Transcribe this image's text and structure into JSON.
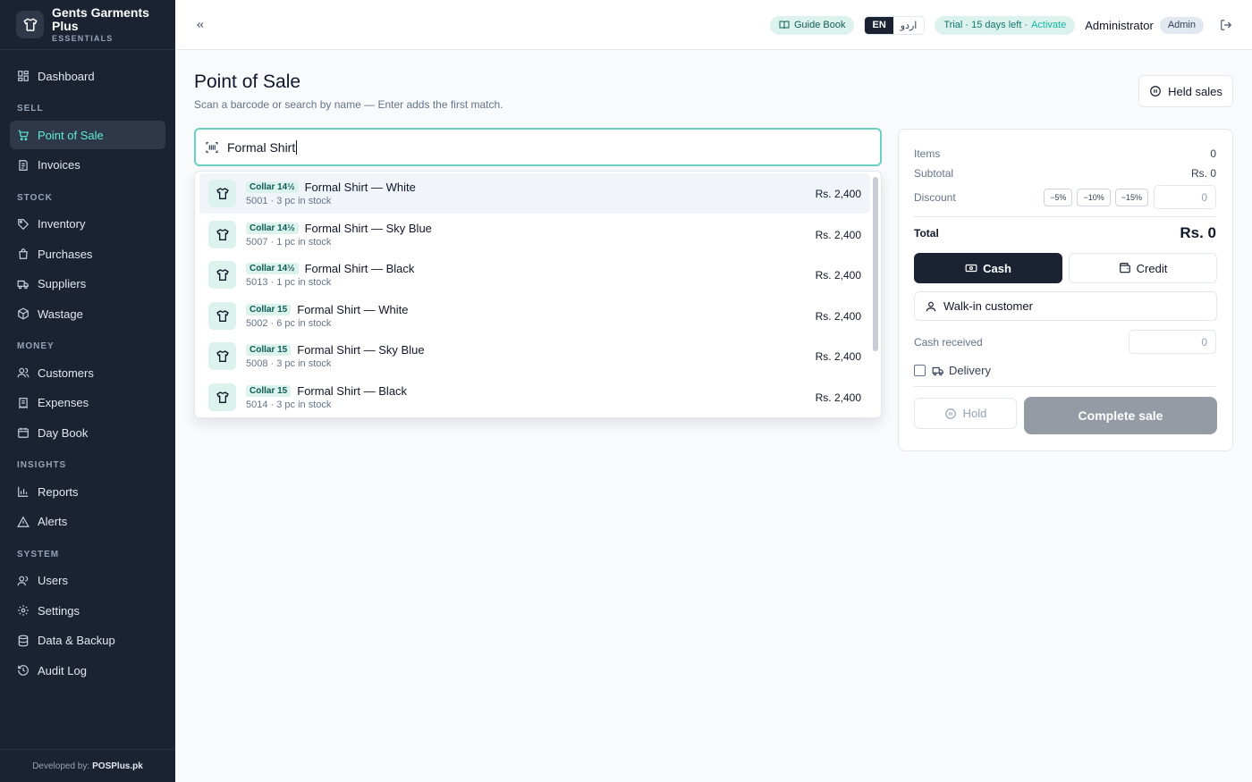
{
  "brand": {
    "name": "Gents Garments Plus",
    "sub": "ESSENTIALS"
  },
  "sidebar": {
    "dashboard": "Dashboard",
    "sections": {
      "sell": "SELL",
      "stock": "STOCK",
      "money": "MONEY",
      "insights": "INSIGHTS",
      "system": "SYSTEM"
    },
    "items": {
      "pos": "Point of Sale",
      "invoices": "Invoices",
      "inventory": "Inventory",
      "purchases": "Purchases",
      "suppliers": "Suppliers",
      "wastage": "Wastage",
      "customers": "Customers",
      "expenses": "Expenses",
      "daybook": "Day Book",
      "reports": "Reports",
      "alerts": "Alerts",
      "users": "Users",
      "settings": "Settings",
      "backup": "Data & Backup",
      "audit": "Audit Log"
    },
    "footer_prefix": "Developed by:",
    "footer_brand": "POSPlus.pk"
  },
  "header": {
    "guide_book": "Guide Book",
    "lang_en": "EN",
    "lang_ur": "اردو",
    "trial": "Trial · 15 days left ·",
    "activate": "Activate",
    "user": "Administrator",
    "role": "Admin"
  },
  "main": {
    "title": "Point of Sale",
    "subtitle": "Scan a barcode or search by name — Enter adds the first match.",
    "held_sales": "Held sales",
    "search_value": "Formal Shirt"
  },
  "results": [
    {
      "collar": "Collar 14½",
      "name": "Formal Shirt — White",
      "meta": "5001 · 3 pc in stock",
      "price": "Rs. 2,400"
    },
    {
      "collar": "Collar 14½",
      "name": "Formal Shirt — Sky Blue",
      "meta": "5007 · 1 pc in stock",
      "price": "Rs. 2,400"
    },
    {
      "collar": "Collar 14½",
      "name": "Formal Shirt — Black",
      "meta": "5013 · 1 pc in stock",
      "price": "Rs. 2,400"
    },
    {
      "collar": "Collar 15",
      "name": "Formal Shirt — White",
      "meta": "5002 · 6 pc in stock",
      "price": "Rs. 2,400"
    },
    {
      "collar": "Collar 15",
      "name": "Formal Shirt — Sky Blue",
      "meta": "5008 · 3 pc in stock",
      "price": "Rs. 2,400"
    },
    {
      "collar": "Collar 15",
      "name": "Formal Shirt — Black",
      "meta": "5014 · 3 pc in stock",
      "price": "Rs. 2,400"
    }
  ],
  "cart": {
    "items_label": "Items",
    "items_value": "0",
    "subtotal_label": "Subtotal",
    "subtotal_value": "Rs. 0",
    "discount_label": "Discount",
    "disc_5": "−5%",
    "disc_10": "−10%",
    "disc_15": "−15%",
    "discount_value": "0",
    "total_label": "Total",
    "total_value": "Rs. 0",
    "cash": "Cash",
    "credit": "Credit",
    "customer": "Walk-in customer",
    "cash_received_label": "Cash received",
    "cash_received_value": "0",
    "delivery": "Delivery",
    "hold": "Hold",
    "complete": "Complete sale"
  },
  "colors": {
    "sidebar_bg": "#1b2333",
    "accent": "#5eead4",
    "accent_soft": "#dcf2ec",
    "primary_dark": "#1b2333",
    "disabled": "#959ba4"
  }
}
